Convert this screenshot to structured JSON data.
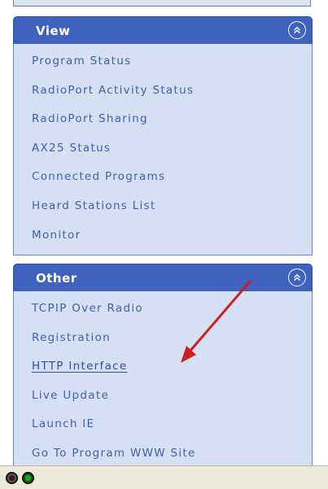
{
  "groups": [
    {
      "title": "View",
      "items": [
        "Program Status",
        "RadioPort Activity Status",
        "RadioPort Sharing",
        "AX25 Status",
        "Connected Programs",
        "Heard Stations List",
        "Monitor"
      ]
    },
    {
      "title": "Other",
      "items": [
        "TCPIP Over Radio",
        "Registration",
        "HTTP Interface",
        "Live Update",
        "Launch IE",
        "Go To Program WWW Site"
      ]
    }
  ],
  "icons": {
    "collapse": "chevron-up-icon",
    "arrow": "red-arrow-annotation",
    "status_lights": [
      "red-status-light-icon",
      "green-status-light-icon"
    ]
  },
  "colors": {
    "header": "#3f62bf",
    "body": "#d6e0f4",
    "link": "#3f5fb4",
    "arrow": "#cc1f1f"
  },
  "highlighted_item": "HTTP Interface"
}
